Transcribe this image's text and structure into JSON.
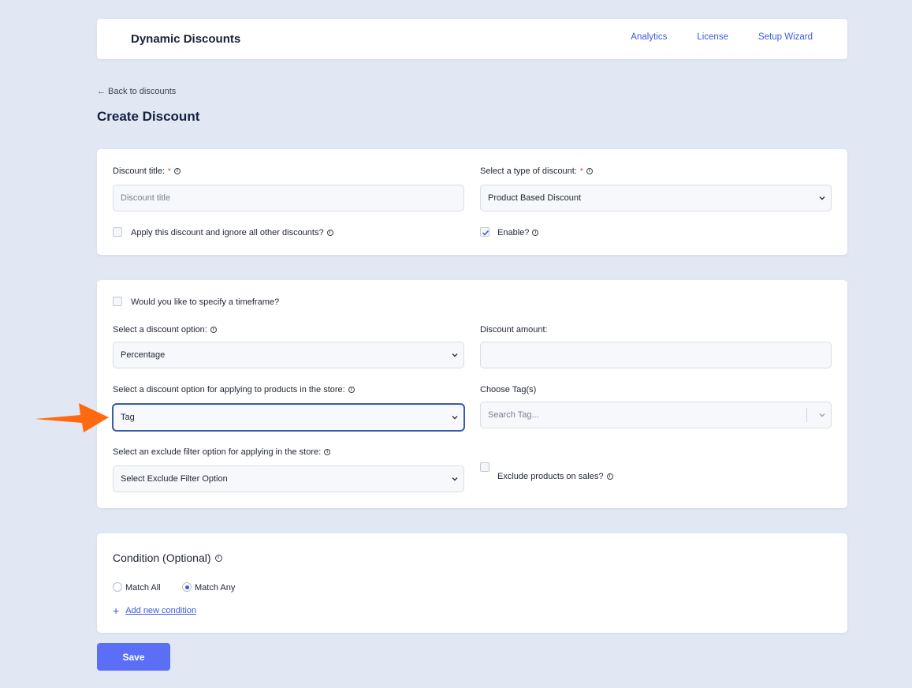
{
  "header": {
    "app_title": "Dynamic Discounts",
    "nav": [
      "Analytics",
      "License",
      "Setup Wizard"
    ]
  },
  "back_link": "← Back to discounts",
  "page_title": "Create Discount",
  "general": {
    "title_label": "Discount title:",
    "title_placeholder": "Discount title",
    "type_label": "Select a type of discount:",
    "type_value": "Product Based Discount",
    "ignore_others_label": "Apply this discount and ignore all other discounts?",
    "ignore_others_checked": false,
    "enable_label": "Enable?",
    "enable_checked": true,
    "required_mark": "*"
  },
  "options": {
    "timeframe_label": "Would you like to specify a timeframe?",
    "discount_option_label": "Select a discount option:",
    "discount_option_value": "Percentage",
    "amount_label": "Discount amount:",
    "amount_value": "",
    "apply_label": "Select a discount option for applying to products in the store:",
    "apply_value": "Tag",
    "tags_label": "Choose Tag(s)",
    "tags_placeholder": "Search Tag...",
    "exclude_label": "Select an exclude filter option for applying in the store:",
    "exclude_value": "Select Exclude Filter Option",
    "exclude_sales_label": "Exclude products on sales?"
  },
  "condition": {
    "title": "Condition (Optional)",
    "match_all": "Match All",
    "match_any": "Match Any",
    "selected": "Match Any",
    "add_label": "Add new condition",
    "add_icon": "+"
  },
  "save_label": "Save",
  "colors": {
    "accent": "#3b5bdb",
    "save": "#5a6ff5",
    "annotation_arrow": "#ff6a10",
    "background": "#e1e8f3"
  }
}
